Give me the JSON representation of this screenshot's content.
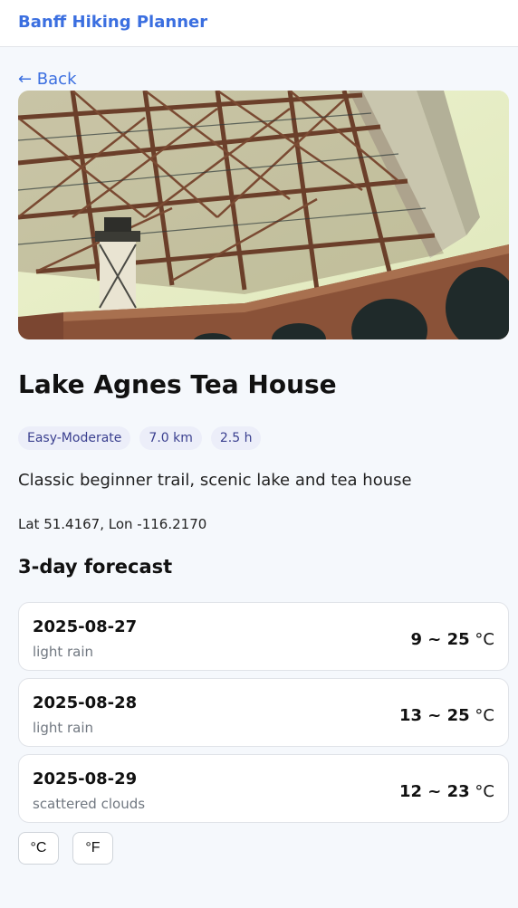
{
  "header": {
    "title": "Banff Hiking Planner"
  },
  "nav": {
    "back_label": "← Back"
  },
  "trail": {
    "name": "Lake Agnes Tea House",
    "tags": [
      "Easy-Moderate",
      "7.0 km",
      "2.5 h"
    ],
    "description": "Classic beginner trail, scenic lake and tea house",
    "coordinates": "Lat 51.4167, Lon -116.2170"
  },
  "forecast": {
    "heading": "3-day forecast",
    "days": [
      {
        "date": "2025-08-27",
        "condition": "light rain",
        "range": "9 ~ 25",
        "unit": "°C"
      },
      {
        "date": "2025-08-28",
        "condition": "light rain",
        "range": "13 ~ 25",
        "unit": "°C"
      },
      {
        "date": "2025-08-29",
        "condition": "scattered clouds",
        "range": "12 ~ 23",
        "unit": "°C"
      }
    ]
  },
  "units": {
    "celsius_label": "°C",
    "fahrenheit_label": "°F"
  },
  "colors": {
    "accent": "#3b6fe0",
    "chip_bg": "#eceef9",
    "chip_text": "#3a3f8f",
    "page_bg": "#f5f8fc"
  }
}
